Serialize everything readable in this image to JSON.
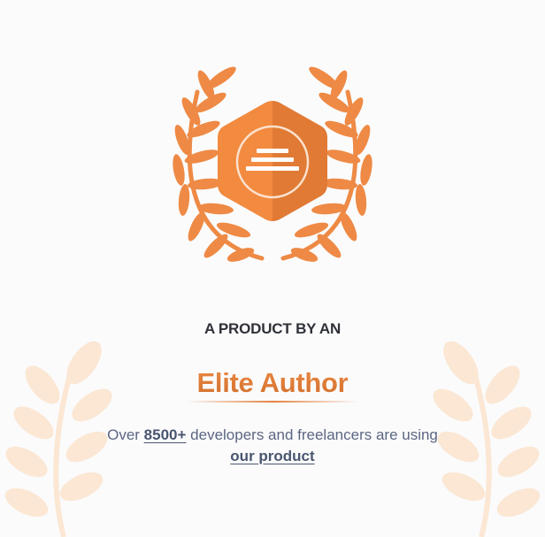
{
  "hero": {
    "tagline": "A PRODUCT BY AN",
    "title": "Elite Author",
    "sub_prefix": "Over",
    "sub_count": "8500+",
    "sub_middle": "developers and freelancers are using",
    "sub_link": "our product"
  },
  "icons": {
    "badge": "elite-author-badge-icon",
    "laurel": "laurel-wreath-icon",
    "wheat": "wheat-branch-icon"
  },
  "colors": {
    "accent": "#e58240",
    "accent_dark": "#d26f2c",
    "badge_face": "#f0883e",
    "text_dark": "#2f3138",
    "text_muted": "#5b6681",
    "background": "#fbfbfc"
  }
}
